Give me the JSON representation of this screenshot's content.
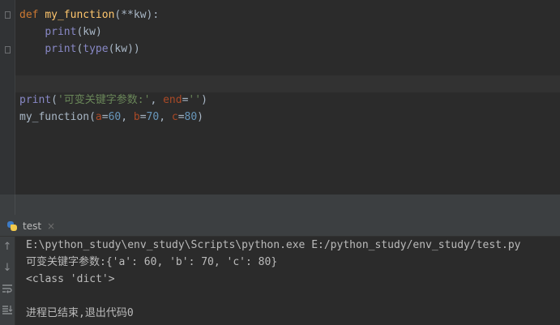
{
  "editor": {
    "lines": [
      {
        "def": "def",
        "name": "my_function",
        "open": "(",
        "star": "**",
        "param": "kw",
        "close": "):"
      },
      {
        "indent": "    ",
        "call": "print",
        "open": "(",
        "arg": "kw",
        "close": ")"
      },
      {
        "indent": "    ",
        "call": "print",
        "open": "(",
        "inner": "type",
        "open2": "(",
        "arg": "kw",
        "close": "))"
      },
      {
        "call": "print",
        "open": "(",
        "str": "'可变关键字参数:'",
        "comma": ", ",
        "kwarg": "end",
        "eq": "=",
        "str2": "''",
        "close": ")"
      },
      {
        "call": "my_function",
        "open": "(",
        "a": "a",
        "eqa": "=",
        "va": "60",
        "c1": ", ",
        "b": "b",
        "eqb": "=",
        "vb": "70",
        "c2": ", ",
        "c": "c",
        "eqc": "=",
        "vc": "80",
        "close": ")"
      }
    ]
  },
  "run": {
    "tab_label": "test",
    "tab_close": "×",
    "output": [
      "E:\\python_study\\env_study\\Scripts\\python.exe E:/python_study/env_study/test.py",
      "可变关键字参数:{'a': 60, 'b': 70, 'c': 80}",
      "<class 'dict'>",
      "",
      "进程已结束,退出代码0"
    ]
  },
  "toolbar": {
    "icons": [
      "arrow-up-icon",
      "arrow-down-icon",
      "soft-wrap-icon",
      "scroll-to-end-icon"
    ]
  }
}
